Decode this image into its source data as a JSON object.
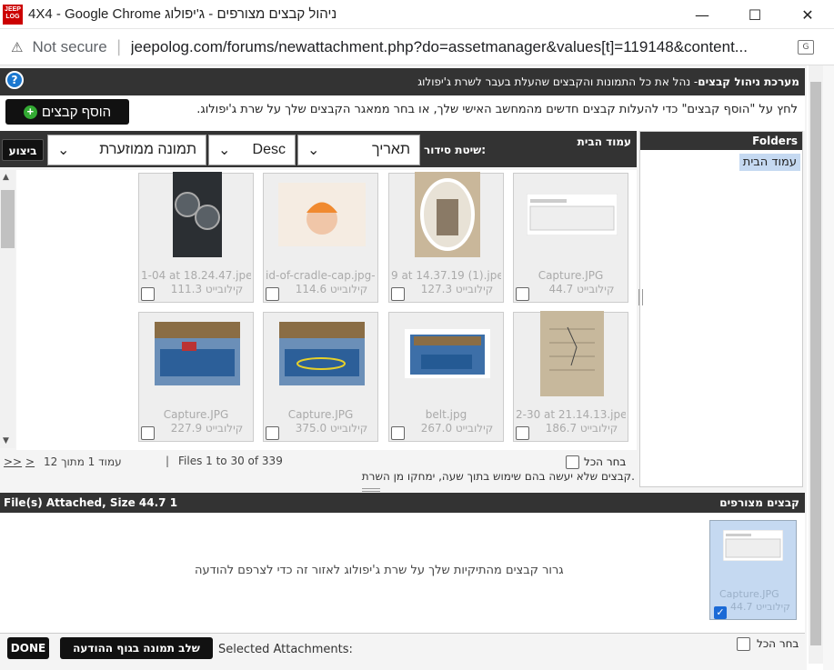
{
  "window": {
    "title": "4X4 - Google Chrome ניהול קבצים מצורפים - ג'יפולוג",
    "favicon_text": "JEEP LOG",
    "controls": [
      "—",
      "☐",
      "✕"
    ]
  },
  "address": {
    "security": "Not secure",
    "url": "jeepolog.com/forums/newattachment.php?do=assetmanager&values[t]=119148&content..."
  },
  "header": {
    "title": "מערכת ניהול קבצים",
    "subtitle": " - נהל את כל התמונות והקבצים שהעלת בעבר לשרת ג'יפולוג",
    "help": "?"
  },
  "info": {
    "text": "לחץ על \"הוסף קבצים\" כדי להעלות קבצים חדשים מהמחשב האישי שלך, או בחר ממאגר הקבצים שלך על שרת ג'יפולוג.",
    "add_button": "הוסף קבצים"
  },
  "folders": {
    "title": "Folders",
    "items": [
      "עמוד הבית"
    ]
  },
  "main": {
    "title": "עמוד הבית",
    "sort_label": "שיטת סידור:",
    "sort_by": "תאריך",
    "order": "Desc",
    "view": "תמונה ממוזערת",
    "go": "ביצוע"
  },
  "files": [
    {
      "name": "Capture.JPG",
      "size": "44.7 קילובייט"
    },
    {
      "name": "9 at 14.37.19 (1).jpeg",
      "size": "127.3 קילובייט"
    },
    {
      "name": "id-of-cradle-cap.jpg-4",
      "size": "114.6 קילובייט"
    },
    {
      "name": "1-04 at 18.24.47.jpeg",
      "size": "111.3 קילובייט"
    },
    {
      "name": "2-30 at 21.14.13.jpeg",
      "size": "186.7 קילובייט"
    },
    {
      "name": "belt.jpg",
      "size": "267.0 קילובייט"
    },
    {
      "name": "Capture.JPG",
      "size": "375.0 קילובייט"
    },
    {
      "name": "Capture.JPG",
      "size": "227.9 קילובייט"
    }
  ],
  "pager": {
    "select_all": "בחר הכל",
    "files_range": "Files 1 to 30 of 339",
    "page": "עמוד 1 מתוך 12",
    "next": ">",
    "last": ">>",
    "footnote": "קבצים שלא יעשה בהם שימוש בתוך שעה, ימחקו מן השרת."
  },
  "attachments": {
    "title": "קבצים מצורפים",
    "summary": "1 File(s) Attached, Size 44.7 קילובייט",
    "dropzone": "גרור קבצים מהתיקיות שלך על שרת ג'יפולוג לאזור זה כדי לצרפם להודעה",
    "item_name": "Capture.JPG",
    "item_size": "44.7 קילובייט"
  },
  "bottom": {
    "select_all": "בחר הכל",
    "selected_label": "Selected Attachments:",
    "insert_button": "שלב תמונה בגוף ההודעה",
    "done_button": "DONE"
  }
}
